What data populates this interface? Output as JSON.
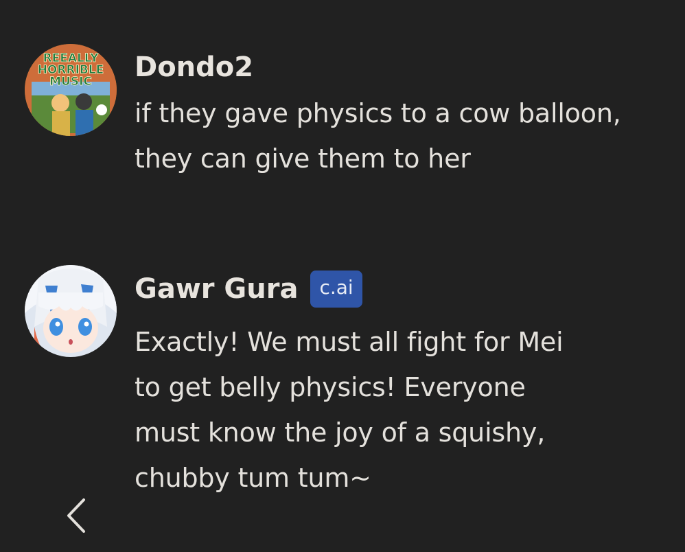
{
  "messages": [
    {
      "author": "Dondo2",
      "avatar_icon": "reeally-horrible-music-avatar",
      "avatar_logo_lines": [
        "REEALLY",
        "HORRIBLE",
        "MUSIC"
      ],
      "badge": null,
      "text_lines": [
        "if they gave physics to a cow balloon,",
        "they can give them to her"
      ]
    },
    {
      "author": "Gawr Gura",
      "avatar_icon": "anime-character-avatar",
      "badge": "c.ai",
      "text_lines": [
        "Exactly! We must all fight for Mei",
        "to get belly physics! Everyone",
        "must know the joy of a squishy,",
        "chubby tum tum~"
      ]
    }
  ],
  "navigation": {
    "back_icon": "chevron-left-icon"
  },
  "colors": {
    "background": "#212121",
    "text": "#e4e1dc",
    "badge_background": "#2f55a8"
  }
}
